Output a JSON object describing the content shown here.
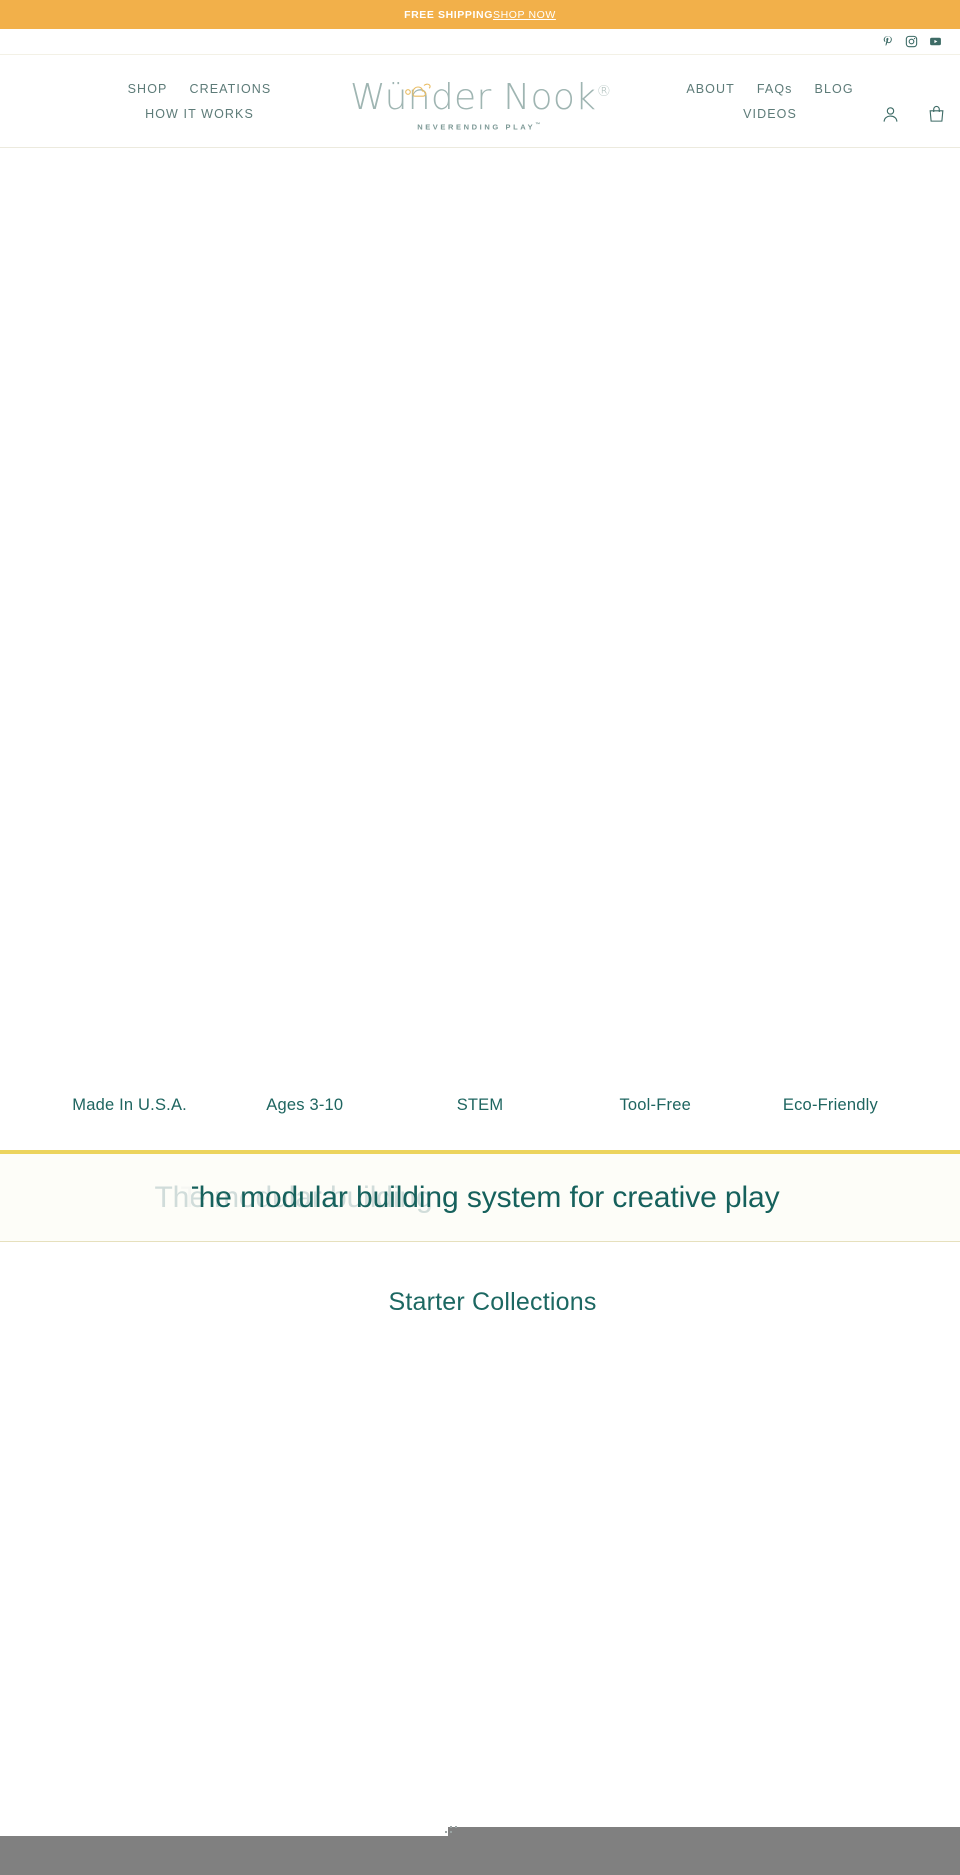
{
  "announcement": {
    "text": "FREE SHIPPING",
    "link_label": "SHOP NOW",
    "bg_color": "#f2b04a",
    "text_color": "#ffffff"
  },
  "social": {
    "items": [
      {
        "name": "pinterest-icon",
        "label": "Pinterest"
      },
      {
        "name": "instagram-icon",
        "label": "Instagram"
      },
      {
        "name": "youtube-icon",
        "label": "YouTube"
      }
    ],
    "color": "#3d6b66"
  },
  "header": {
    "nav_left": [
      {
        "label": "SHOP"
      },
      {
        "label": "CREATIONS"
      },
      {
        "label": "HOW IT WORKS"
      }
    ],
    "nav_right": [
      {
        "label": "ABOUT"
      },
      {
        "label": "FAQs"
      },
      {
        "label": "BLOG"
      },
      {
        "label": "VIDEOS"
      }
    ],
    "logo": {
      "wordmark": "Wünder Nook",
      "registered": "®",
      "tagline": "NEVERENDING PLAY",
      "trademark": "™",
      "color": "#9fb5b2"
    },
    "icons": [
      {
        "name": "account-icon",
        "label": "Account"
      },
      {
        "name": "cart-icon",
        "label": "Cart"
      }
    ],
    "nav_color": "#5d7b78"
  },
  "features": {
    "items": [
      {
        "label": "Made In U.S.A."
      },
      {
        "label": "Ages 3-10"
      },
      {
        "label": "STEM"
      },
      {
        "label": "Tool-Free"
      },
      {
        "label": "Eco-Friendly"
      }
    ],
    "color": "#1e6560",
    "divider_color": "#ecd45d"
  },
  "headline": {
    "text": "The modular building system for creative play",
    "color": "#16615c"
  },
  "collections": {
    "title": "Starter Collections",
    "color": "#1c6862"
  }
}
